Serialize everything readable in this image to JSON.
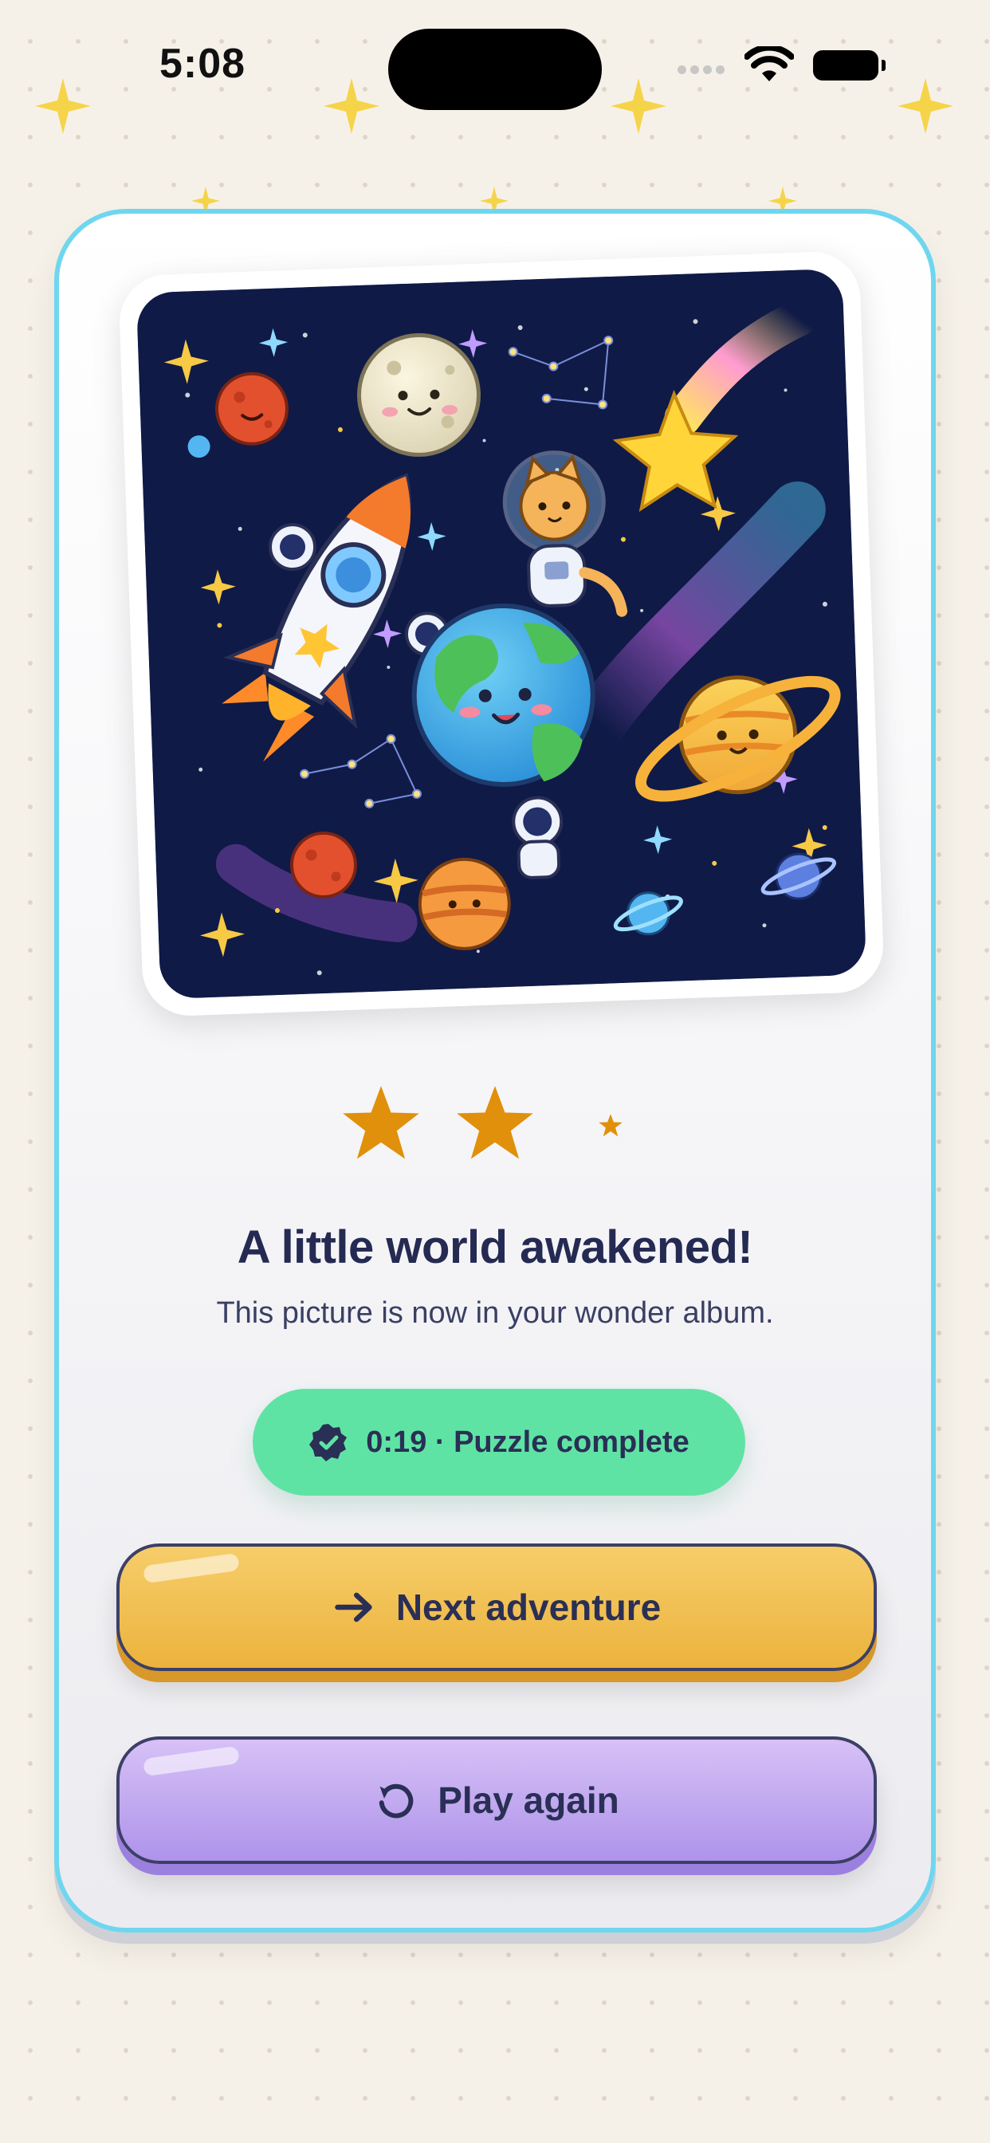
{
  "status_bar": {
    "time": "5:08"
  },
  "result": {
    "rating": {
      "earned": 2,
      "total": 3
    },
    "title": "A little world awakened!",
    "subtitle": "This picture is now in your wonder album.",
    "time_badge": "0:19 · Puzzle complete"
  },
  "actions": {
    "next_label": "Next adventure",
    "replay_label": "Play again"
  },
  "colors": {
    "card_border": "#6fd6ef",
    "star": "#e0900a",
    "badge": "#5fe3a4",
    "next_button": "#ecb33d",
    "replay_button": "#ae93ea",
    "text": "#25294f"
  },
  "icons": {
    "badge": "verified-check-icon",
    "next": "arrow-right-icon",
    "replay": "replay-icon"
  }
}
